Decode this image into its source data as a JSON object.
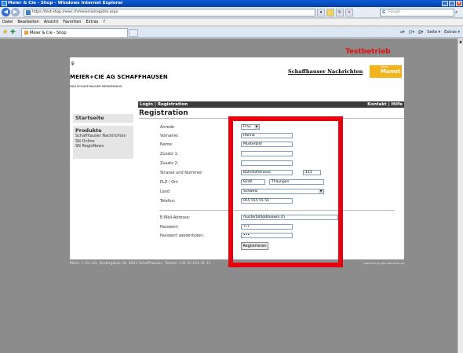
{
  "window": {
    "title": "Meier & Cie - Shop - Windows Internet Explorer"
  },
  "address": {
    "url": "https://test.shop.meier.ch/meiercie/register.aspx",
    "search_placeholder": "Google"
  },
  "menubar": [
    "Datei",
    "Bearbeiten",
    "Ansicht",
    "Favoriten",
    "Extras",
    "?"
  ],
  "tab": {
    "label": "Meier & Cie - Shop"
  },
  "toolbar": {
    "page_label": "Seite",
    "extras_label": "Extras"
  },
  "environment_badge": "Testbetrieb",
  "brand": {
    "title": "MEIER+CIE AG SCHAFFHAUSEN",
    "subtitle": "DAS SCHAFFHAUSER MEDIENHAUS",
    "sn_logo": "Schaffhauser Nachrichten",
    "munot_tag": "Radio",
    "munot": "Munot"
  },
  "topnav": {
    "left": "Login | Registration",
    "right": "Kontakt | Hilfe"
  },
  "sidebar": {
    "home": "Startseite",
    "products_heading": "Produkte",
    "products": [
      "Schaffhauser Nachrichten",
      "SN Online",
      "SN RegioNews"
    ]
  },
  "form": {
    "title": "Registration",
    "labels": {
      "anrede": "Anrede",
      "vorname": "Vorname:",
      "name": "Name:",
      "zusatz1": "Zusatz 1:",
      "zusatz2": "Zusatz 2:",
      "strasse": "Strasse und Nummer:",
      "plz": "PLZ / Ort:",
      "land": "Land",
      "telefon": "Telefon:",
      "email": "E-Mail-Adresse:",
      "passwort": "Passwort:",
      "passwort2": "Passwort wiederholen:"
    },
    "values": {
      "anrede": "Frau",
      "vorname": "Hanna",
      "name": "Musterbild",
      "zusatz1": "",
      "zusatz2": "",
      "strasse": "Bahnhofstrasse",
      "hausnummer": "111",
      "plz": "8240",
      "ort": "Thayngen",
      "land": "Schweiz",
      "telefon": "055 555 55 55",
      "email": "musterbild@bluewin.ch",
      "passwort": "•••",
      "passwort2": "•••"
    },
    "submit": "Registrieren"
  },
  "footer": {
    "text": "Meier + Cie AG, Vordergasse 58, 8201 Schaffhausen, Telefon +41 52 633 31 11",
    "powered": "powered by adp swisscom ag"
  },
  "colors": {
    "highlight": "#e8000f",
    "badge": "#e01010",
    "nav": "#3b3b3b"
  }
}
